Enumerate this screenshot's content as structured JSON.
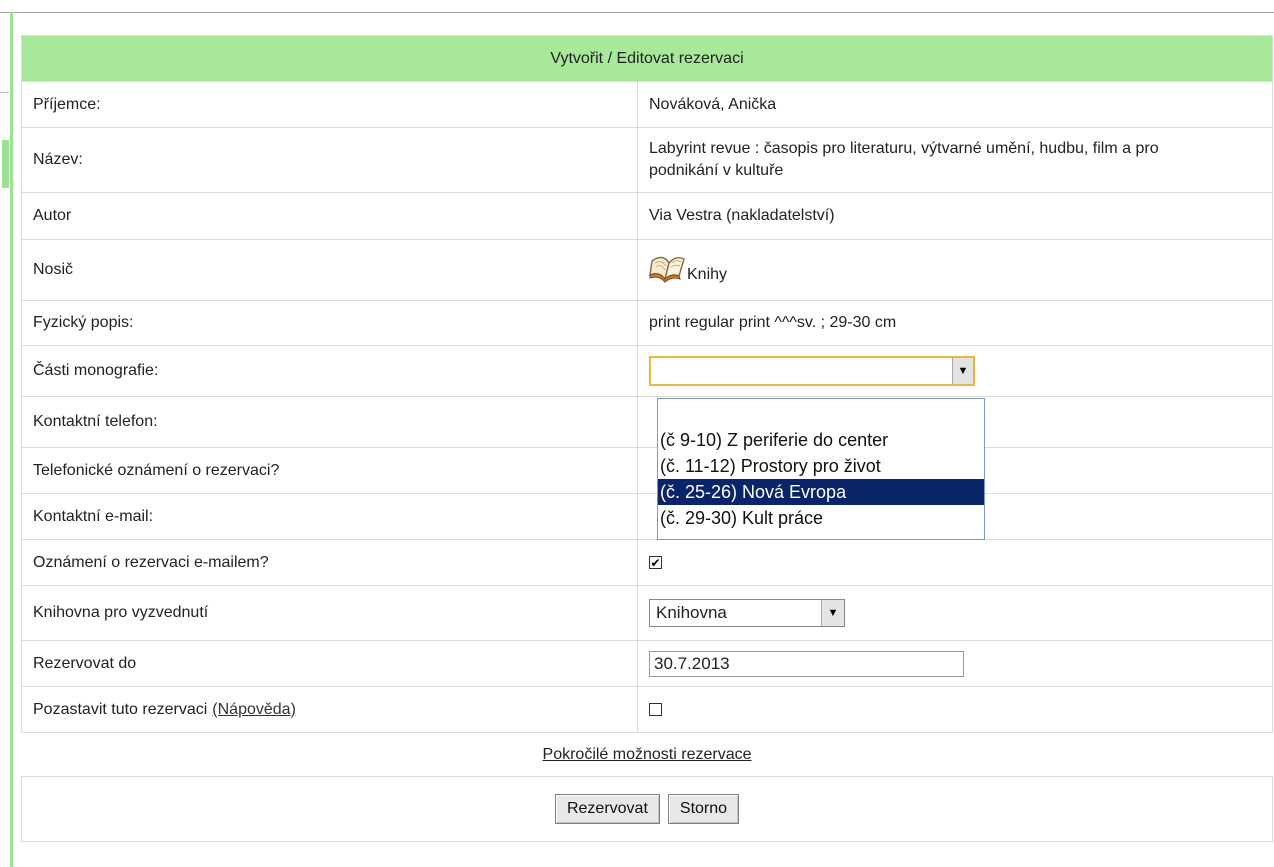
{
  "header_title": "Vytvořit / Editovat rezervaci",
  "rows": {
    "recipient": {
      "label": "Příjemce:",
      "value": "Nováková, Anička"
    },
    "title": {
      "label": "Název:",
      "value": "Labyrint revue : časopis pro literaturu, výtvarné umění, hudbu, film a pro podnikání v kultuře"
    },
    "author": {
      "label": "Autor",
      "value": "Via Vestra (nakladatelství)"
    },
    "medium": {
      "label": "Nosič",
      "value": "Knihy",
      "icon": "open-book-icon"
    },
    "physical": {
      "label": "Fyzický popis:",
      "value": "print regular print ^^^sv. ; 29-30 cm"
    },
    "parts": {
      "label": "Části monografie:",
      "value": ""
    },
    "phone": {
      "label": "Kontaktní telefon:"
    },
    "phone_notify": {
      "label": "Telefonické oznámení o rezervaci?"
    },
    "email": {
      "label": "Kontaktní e-mail:"
    },
    "email_notify": {
      "label": "Oznámení o rezervaci e-mailem?",
      "checked": true
    },
    "library": {
      "label": "Knihovna pro vyzvednutí",
      "value": "Knihovna"
    },
    "reserve_until": {
      "label": "Rezervovat do",
      "value": "30.7.2013"
    },
    "suspend": {
      "label": "Pozastavit tuto rezervaci",
      "help_link": "(Nápověda)",
      "checked": false
    }
  },
  "dropdown_options": [
    "",
    "(č 9-10) Z periferie do center",
    "(č. 11-12) Prostory pro život",
    "(č. 25-26) Nová Evropa",
    "(č. 29-30) Kult práce"
  ],
  "dropdown_selected_index": 3,
  "advanced_link": "Pokročilé možnosti rezervace",
  "buttons": {
    "reserve": "Rezervovat",
    "cancel": "Storno"
  },
  "colors": {
    "header_bg": "#a8e89b",
    "selected_option_bg": "#0a246a",
    "combo_focus_border": "#e6b840"
  }
}
